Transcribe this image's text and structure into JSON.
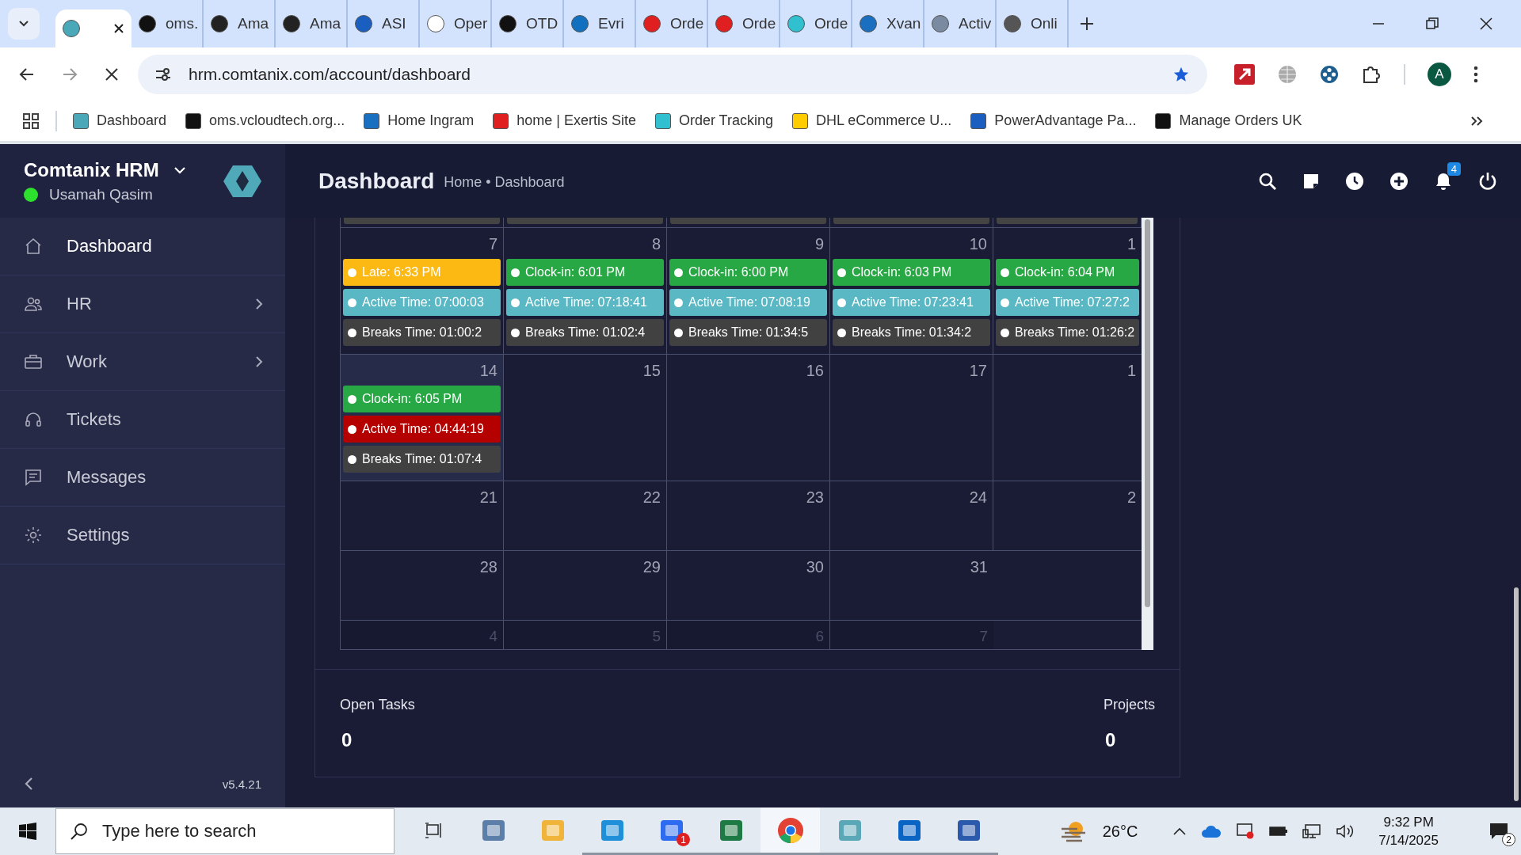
{
  "browser": {
    "tabs": [
      {
        "selected": true
      },
      {
        "title": "oms.",
        "selected": false
      },
      {
        "title": "Ama",
        "selected": false
      },
      {
        "title": "Ama",
        "selected": false
      },
      {
        "title": "ASI",
        "selected": false
      },
      {
        "title": "Oper",
        "selected": false
      },
      {
        "title": "OTD",
        "selected": false
      },
      {
        "title": "Evri",
        "selected": false
      },
      {
        "title": "Orde",
        "selected": false
      },
      {
        "title": "Orde",
        "selected": false
      },
      {
        "title": "Orde",
        "selected": false
      },
      {
        "title": "Xvan",
        "selected": false
      },
      {
        "title": "Activ",
        "selected": false
      },
      {
        "title": "Onli",
        "selected": false
      }
    ],
    "address": "hrm.comtanix.com/account/dashboard",
    "profile_initial": "A",
    "bookmarks": [
      "Dashboard",
      "oms.vcloudtech.org...",
      "Home Ingram",
      "home | Exertis Site",
      "Order Tracking",
      "DHL eCommerce U...",
      "PowerAdvantage Pa...",
      "Manage Orders UK"
    ]
  },
  "app": {
    "brand": "Comtanix HRM",
    "user": "Usamah Qasim",
    "user_online": true,
    "page_title": "Dashboard",
    "breadcrumb": "Home • Dashboard",
    "notification_count": "4"
  },
  "sidebar": {
    "items": [
      {
        "label": "Dashboard",
        "selected": true,
        "expandable": false
      },
      {
        "label": "HR",
        "selected": false,
        "expandable": true
      },
      {
        "label": "Work",
        "selected": false,
        "expandable": true
      },
      {
        "label": "Tickets",
        "selected": false,
        "expandable": false
      },
      {
        "label": "Messages",
        "selected": false,
        "expandable": false
      },
      {
        "label": "Settings",
        "selected": false,
        "expandable": false
      }
    ],
    "version": "v5.4.21"
  },
  "calendar": {
    "weeks": [
      {
        "days": [
          {
            "day": "7",
            "today": false,
            "muted": false,
            "events": [
              {
                "text": "Late: 6:33 PM",
                "color": "#fcb813"
              },
              {
                "text": "Active Time: 07:00:03",
                "color": "#5ab7c4"
              },
              {
                "text": "Breaks Time: 01:00:2",
                "color": "#414141"
              }
            ]
          },
          {
            "day": "8",
            "today": false,
            "muted": false,
            "events": [
              {
                "text": "Clock-in: 6:01 PM",
                "color": "#28a745"
              },
              {
                "text": "Active Time: 07:18:41",
                "color": "#5ab7c4"
              },
              {
                "text": "Breaks Time: 01:02:4",
                "color": "#414141"
              }
            ]
          },
          {
            "day": "9",
            "today": false,
            "muted": false,
            "events": [
              {
                "text": "Clock-in: 6:00 PM",
                "color": "#28a745"
              },
              {
                "text": "Active Time: 07:08:19",
                "color": "#5ab7c4"
              },
              {
                "text": "Breaks Time: 01:34:5",
                "color": "#414141"
              }
            ]
          },
          {
            "day": "10",
            "today": false,
            "muted": false,
            "events": [
              {
                "text": "Clock-in: 6:03 PM",
                "color": "#28a745"
              },
              {
                "text": "Active Time: 07:23:41",
                "color": "#5ab7c4"
              },
              {
                "text": "Breaks Time: 01:34:2",
                "color": "#414141"
              }
            ]
          },
          {
            "day": "1",
            "today": false,
            "muted": false,
            "events": [
              {
                "text": "Clock-in: 6:04 PM",
                "color": "#28a745"
              },
              {
                "text": "Active Time: 07:27:2",
                "color": "#5ab7c4"
              },
              {
                "text": "Breaks Time: 01:26:2",
                "color": "#414141"
              }
            ]
          }
        ]
      },
      {
        "days": [
          {
            "day": "14",
            "today": true,
            "muted": false,
            "events": [
              {
                "text": "Clock-in: 6:05 PM",
                "color": "#28a745"
              },
              {
                "text": "Active Time: 04:44:19",
                "color": "#b50000"
              },
              {
                "text": "Breaks Time: 01:07:4",
                "color": "#414141"
              }
            ]
          },
          {
            "day": "15",
            "today": false,
            "muted": false
          },
          {
            "day": "16",
            "today": false,
            "muted": false
          },
          {
            "day": "17",
            "today": false,
            "muted": false
          },
          {
            "day": "1",
            "today": false,
            "muted": false
          }
        ]
      },
      {
        "days": [
          {
            "day": "21",
            "today": false,
            "muted": false
          },
          {
            "day": "22",
            "today": false,
            "muted": false
          },
          {
            "day": "23",
            "today": false,
            "muted": false
          },
          {
            "day": "24",
            "today": false,
            "muted": false
          },
          {
            "day": "2",
            "today": false,
            "muted": false
          }
        ]
      },
      {
        "days": [
          {
            "day": "28",
            "today": false,
            "muted": false
          },
          {
            "day": "29",
            "today": false,
            "muted": false
          },
          {
            "day": "30",
            "today": false,
            "muted": false
          },
          {
            "day": "31",
            "today": false,
            "muted": false
          }
        ]
      },
      {
        "days": [
          {
            "day": "4",
            "today": false,
            "muted": true
          },
          {
            "day": "5",
            "today": false,
            "muted": true
          },
          {
            "day": "6",
            "today": false,
            "muted": true
          },
          {
            "day": "7",
            "today": false,
            "muted": true
          }
        ]
      }
    ]
  },
  "summary": [
    {
      "label": "Open Tasks",
      "value": "0"
    },
    {
      "label": "Projects",
      "value": "0"
    }
  ],
  "taskbar": {
    "search_placeholder": "Type here to search",
    "apps": [
      {
        "kind": "taskview",
        "running": false,
        "selected": false
      },
      {
        "kind": "calculator",
        "running": false,
        "selected": false
      },
      {
        "kind": "explorer",
        "running": false,
        "selected": false
      },
      {
        "kind": "edge",
        "running": true,
        "selected": false
      },
      {
        "kind": "zoom",
        "running": true,
        "selected": false,
        "badge": "1"
      },
      {
        "kind": "excel",
        "running": true,
        "selected": false
      },
      {
        "kind": "chrome",
        "running": true,
        "selected": true
      },
      {
        "kind": "hrm",
        "running": true,
        "selected": false
      },
      {
        "kind": "outlook",
        "running": true,
        "selected": false
      },
      {
        "kind": "word",
        "running": true,
        "selected": false
      }
    ],
    "weather": "26°C",
    "time": "9:32 PM",
    "date": "7/14/2025",
    "notifications": "2"
  }
}
